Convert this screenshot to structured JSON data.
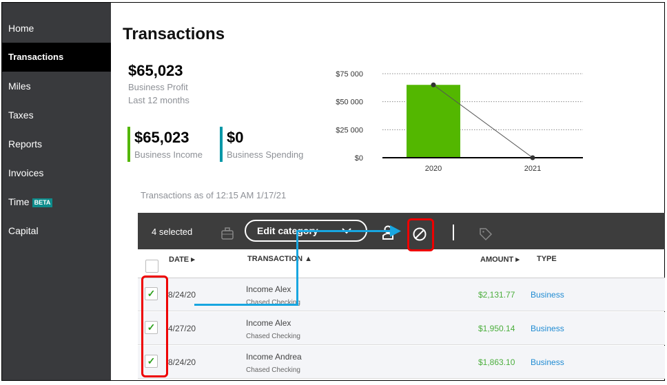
{
  "sidebar": {
    "items": [
      {
        "label": "Home"
      },
      {
        "label": "Transactions",
        "active": true
      },
      {
        "label": "Miles"
      },
      {
        "label": "Taxes"
      },
      {
        "label": "Reports"
      },
      {
        "label": "Invoices"
      },
      {
        "label": "Time",
        "badge": "BETA"
      },
      {
        "label": "Capital"
      }
    ]
  },
  "page": {
    "title": "Transactions"
  },
  "summary": {
    "profit": "$65,023",
    "profit_label": "Business Profit",
    "period": "Last 12 months",
    "income": "$65,023",
    "income_label": "Business Income",
    "spending": "$0",
    "spending_label": "Business Spending",
    "income_color": "#53b700",
    "spending_color": "#0097a7"
  },
  "as_of": "Transactions as of 12:15 AM 1/17/21",
  "chart_data": {
    "type": "bar",
    "categories": [
      "2020",
      "2021"
    ],
    "series": [
      {
        "type": "bar",
        "values": [
          65023,
          0
        ],
        "color": "#53b700"
      },
      {
        "type": "line",
        "values": [
          65023,
          0
        ],
        "color": "#555555"
      }
    ],
    "yticks": [
      "$0",
      "$25 000",
      "$50 000",
      "$75 000"
    ],
    "ytick_values": [
      0,
      25000,
      50000,
      75000
    ],
    "ylim": [
      0,
      75000
    ],
    "grid": true
  },
  "toolbar": {
    "selected": "4 selected",
    "edit_category": "Edit category"
  },
  "table": {
    "headers": {
      "date": "DATE",
      "transaction": "TRANSACTION",
      "amount": "AMOUNT",
      "type": "TYPE"
    },
    "rows": [
      {
        "date": "8/24/20",
        "name": "Income Alex",
        "account": "Chased Checking",
        "amount": "$2,131.77",
        "type": "Business",
        "checked": true
      },
      {
        "date": "4/27/20",
        "name": "Income Alex",
        "account": "Chased Checking",
        "amount": "$1,950.14",
        "type": "Business",
        "checked": true
      },
      {
        "date": "8/24/20",
        "name": "Income Andrea",
        "account": "Chased Checking",
        "amount": "$1,863.10",
        "type": "Business",
        "checked": true
      }
    ]
  }
}
